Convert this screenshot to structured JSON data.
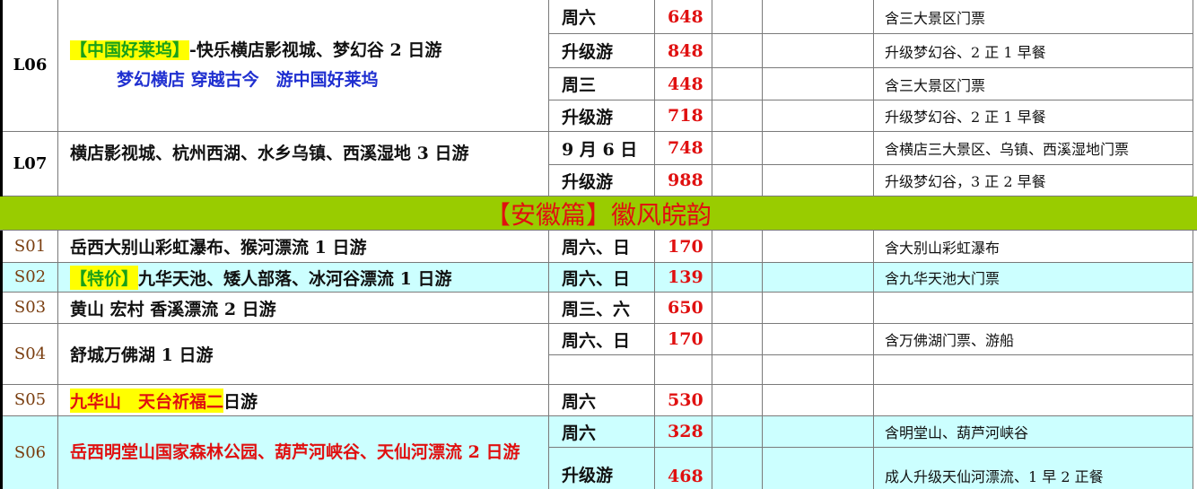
{
  "rows": {
    "l06": {
      "code": "L06",
      "tag": "【中国好莱坞】",
      "title_rest": "-快乐横店影视城、梦幻谷 2 日游",
      "subtitle": "梦幻横店 穿越古今　游中国好莱坞",
      "lines": [
        {
          "day": "周六",
          "price": "648",
          "note": "含三大景区门票"
        },
        {
          "day": "升级游",
          "price": "848",
          "note": "升级梦幻谷、2 正 1 早餐"
        },
        {
          "day": "周三",
          "price": "448",
          "note": "含三大景区门票"
        },
        {
          "day": "升级游",
          "price": "718",
          "note": "升级梦幻谷、2 正 1 早餐"
        }
      ]
    },
    "l07": {
      "code": "L07",
      "title": "横店影视城、杭州西湖、水乡乌镇、西溪湿地 3 日游",
      "lines": [
        {
          "day": "9 月 6 日",
          "price": "748",
          "note": "含横店三大景区、乌镇、西溪湿地门票"
        },
        {
          "day": "升级游",
          "price": "988",
          "note": "升级梦幻谷，3 正 2 早餐"
        }
      ]
    },
    "banner": "【安徽篇】徽风皖韵",
    "s01": {
      "code": "S01",
      "title": "岳西大别山彩虹瀑布、猴河漂流 1 日游",
      "day": "周六、日",
      "price": "170",
      "note": "含大别山彩虹瀑布"
    },
    "s02": {
      "code": "S02",
      "tag": "【特价】",
      "title_rest": "九华天池、矮人部落、冰河谷漂流 1 日游",
      "day": "周六、日",
      "price": "139",
      "note": "含九华天池大门票"
    },
    "s03": {
      "code": "S03",
      "title": "黄山 宏村 香溪漂流 2 日游",
      "day": "周三、六",
      "price": "650",
      "note": ""
    },
    "s04": {
      "code": "S04",
      "title": "舒城万佛湖 1 日游",
      "day": "周六、日",
      "price": "170",
      "note": "含万佛湖门票、游船"
    },
    "s05": {
      "code": "S05",
      "tag": "九华山　天台祈福二",
      "title_rest": "日游",
      "day": "周六",
      "price": "530",
      "note": ""
    },
    "s06": {
      "code": "S06",
      "title": "岳西明堂山国家森林公园、葫芦河峡谷、天仙河漂流 2 日游",
      "lines": [
        {
          "day": "周六",
          "price": "328",
          "note": "含明堂山、葫芦河峡谷"
        },
        {
          "day": "升级游",
          "price": "468",
          "note": "成人升级天仙河漂流、1 早 2 正餐"
        }
      ]
    }
  }
}
